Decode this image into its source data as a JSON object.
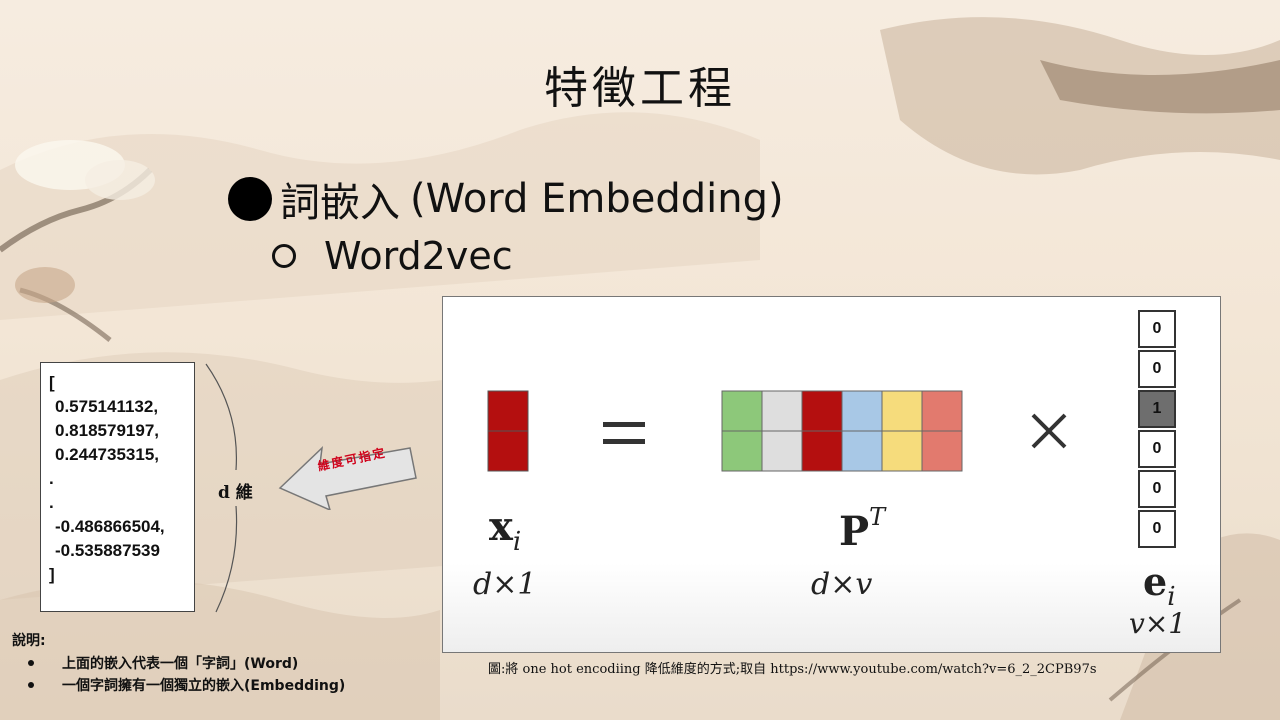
{
  "slide": {
    "title": "特徵工程",
    "bullet_l1_cjk": "詞嵌入",
    "bullet_l1_en": "(Word Embedding)",
    "bullet_l2": "Word2vec"
  },
  "vector": {
    "open": "[",
    "values": [
      "0.575141132,",
      "0.818579197,",
      "0.244735315,",
      ".",
      ".",
      "-0.486866504,",
      "-0.535887539"
    ],
    "close": "]"
  },
  "dimension_label": "d 維",
  "arrow_note": "維度可指定",
  "figure": {
    "equals": "=",
    "times": "×",
    "x_label": "x",
    "x_sub": "i",
    "x_dim": "d×1",
    "p_label": "P",
    "p_sup": "T",
    "p_dim": "d×v",
    "e_label": "e",
    "e_sub": "i",
    "e_dim": "v×1",
    "onehot": [
      "0",
      "0",
      "1",
      "0",
      "0",
      "0"
    ],
    "p_colors": [
      "#8dc87a",
      "#dedede",
      "#b40f0f",
      "#a8c8e6",
      "#f6dc7c",
      "#e27a6e"
    ],
    "x_color": "#b40f0f"
  },
  "explain": {
    "title": "說明:",
    "items": [
      "上面的嵌入代表一個「字詞」(Word)",
      "一個字詞擁有一個獨立的嵌入(Embedding)"
    ]
  },
  "caption": "圖:將 one hot encodiing 降低維度的方式;取自 https://www.youtube.com/watch?v=6_2_2CPB97s"
}
